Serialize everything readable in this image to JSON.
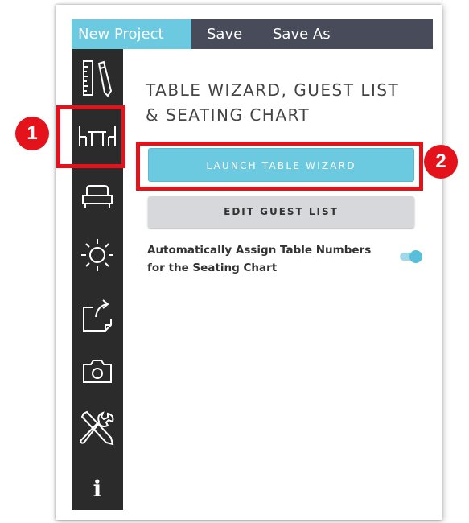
{
  "toolbar": {
    "new_project": "New Project",
    "save": "Save",
    "save_as": "Save As"
  },
  "sidebar": {
    "items": [
      {
        "icon": "ruler-pencil-icon"
      },
      {
        "icon": "table-chairs-icon"
      },
      {
        "icon": "sofa-icon"
      },
      {
        "icon": "light-icon"
      },
      {
        "icon": "export-icon"
      },
      {
        "icon": "camera-icon"
      },
      {
        "icon": "tools-icon"
      },
      {
        "icon": "info-icon",
        "glyph": "i"
      }
    ]
  },
  "panel": {
    "title": "TABLE WIZARD, GUEST LIST & SEATING CHART",
    "launch_button": "LAUNCH TABLE WIZARD",
    "guest_button": "EDIT GUEST LIST",
    "auto_assign_label": "Automatically Assign Table Numbers for the Seating Chart",
    "auto_assign_on": true
  },
  "callouts": {
    "one": "1",
    "two": "2"
  },
  "colors": {
    "accent": "#6ccae0",
    "toolbar": "#474b5a",
    "sidebar": "#2b2b2b",
    "callout": "#e4131b"
  }
}
